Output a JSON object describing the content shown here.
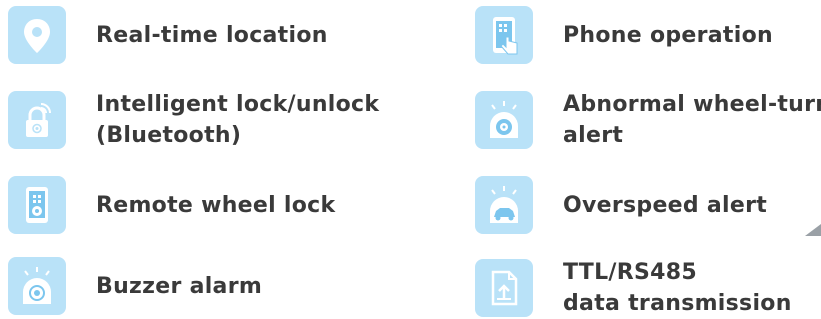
{
  "colors": {
    "icon_bg": "#b9e2f8",
    "icon_fg": "#ffffff",
    "icon_shade": "#7cc6ee",
    "text": "#3a3a3a"
  },
  "features_left": [
    {
      "icon": "location-pin-icon",
      "lines": [
        "Real-time location"
      ]
    },
    {
      "icon": "bluetooth-lock-icon",
      "lines": [
        "Intelligent lock/unlock",
        "(Bluetooth)"
      ]
    },
    {
      "icon": "phone-wheel-lock-icon",
      "lines": [
        "Remote wheel lock"
      ]
    },
    {
      "icon": "siren-alarm-icon",
      "lines": [
        "Buzzer alarm"
      ]
    }
  ],
  "features_right": [
    {
      "icon": "phone-touch-icon",
      "lines": [
        "Phone operation"
      ]
    },
    {
      "icon": "wheel-alert-icon",
      "lines": [
        "Abnormal wheel-turn",
        "alert"
      ]
    },
    {
      "icon": "car-speed-alert-icon",
      "lines": [
        "Overspeed alert"
      ]
    },
    {
      "icon": "data-transfer-icon",
      "lines": [
        "TTL/RS485",
        "data transmission"
      ]
    }
  ]
}
